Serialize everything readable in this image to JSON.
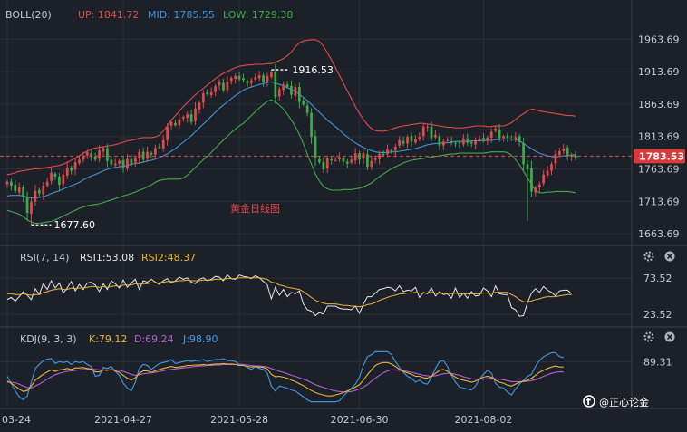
{
  "chart_data": [
    {
      "type": "candlestick",
      "panel": "price",
      "annotation": "黄金日线图",
      "indicator": {
        "label": "BOLL(20)",
        "up": {
          "label": "UP: 1841.72",
          "color": "#e04a4a"
        },
        "mid": {
          "label": "MID: 1785.55",
          "color": "#3f93d6"
        },
        "low": {
          "label": "LOW: 1729.38",
          "color": "#3faa4c"
        }
      },
      "ylim": [
        1650,
        1985
      ],
      "y_ticks": [
        "1963.69",
        "1913.69",
        "1863.69",
        "1813.69",
        "1763.69",
        "1713.69",
        "1663.69"
      ],
      "current_price": "1783.53",
      "current_price_value": 1783.53,
      "high_marker": {
        "label": "1916.53",
        "value": 1916.53
      },
      "low_marker": {
        "label": "1677.60",
        "value": 1677.6
      },
      "up_color": "#e04a4a",
      "down_color": "#3faa4c",
      "close": [
        1744,
        1738,
        1729,
        1735,
        1720,
        1696,
        1713,
        1730,
        1726,
        1738,
        1744,
        1758,
        1752,
        1739,
        1755,
        1766,
        1761,
        1774,
        1778,
        1783,
        1790,
        1783,
        1778,
        1792,
        1796,
        1776,
        1771,
        1772,
        1776,
        1766,
        1779,
        1772,
        1781,
        1790,
        1778,
        1790,
        1786,
        1796,
        1797,
        1808,
        1829,
        1836,
        1831,
        1840,
        1844,
        1848,
        1836,
        1857,
        1866,
        1880,
        1879,
        1882,
        1891,
        1898,
        1885,
        1898,
        1904,
        1907,
        1902,
        1901,
        1896,
        1900,
        1905,
        1908,
        1897,
        1907,
        1913,
        1874,
        1887,
        1894,
        1890,
        1878,
        1890,
        1867,
        1863,
        1850,
        1813,
        1780,
        1774,
        1763,
        1780,
        1777,
        1777,
        1782,
        1775,
        1772,
        1778,
        1788,
        1778,
        1788,
        1767,
        1776,
        1780,
        1787,
        1785,
        1794,
        1792,
        1798,
        1808,
        1803,
        1813,
        1806,
        1810,
        1813,
        1829,
        1829,
        1811,
        1816,
        1800,
        1806,
        1808,
        1804,
        1803,
        1803,
        1811,
        1804,
        1803,
        1808,
        1810,
        1808,
        1812,
        1821,
        1826,
        1811,
        1814,
        1812,
        1809,
        1813,
        1805,
        1771,
        1763,
        1729,
        1735,
        1740,
        1755,
        1761,
        1771,
        1787,
        1791,
        1795,
        1784,
        1785,
        1780
      ],
      "mid": [
        1722,
        1723,
        1723,
        1723,
        1722,
        1720,
        1719,
        1719,
        1720,
        1721,
        1723,
        1726,
        1728,
        1730,
        1733,
        1735,
        1738,
        1740,
        1743,
        1747,
        1750,
        1753,
        1755,
        1758,
        1761,
        1763,
        1765,
        1766,
        1767,
        1768,
        1769,
        1771,
        1772,
        1773,
        1774,
        1776,
        1777,
        1779,
        1781,
        1784,
        1787,
        1791,
        1795,
        1800,
        1805,
        1810,
        1815,
        1821,
        1827,
        1833,
        1839,
        1845,
        1851,
        1857,
        1862,
        1867,
        1872,
        1877,
        1881,
        1885,
        1888,
        1890,
        1892,
        1894,
        1895,
        1897,
        1898,
        1896,
        1894,
        1892,
        1889,
        1886,
        1883,
        1879,
        1874,
        1869,
        1863,
        1857,
        1851,
        1845,
        1839,
        1834,
        1829,
        1824,
        1818,
        1813,
        1808,
        1804,
        1800,
        1797,
        1794,
        1792,
        1790,
        1789,
        1789,
        1789,
        1790,
        1790,
        1791,
        1792,
        1793,
        1794,
        1795,
        1797,
        1799,
        1801,
        1802,
        1803,
        1803,
        1804,
        1804,
        1805,
        1806,
        1806,
        1806,
        1806,
        1807,
        1807,
        1807,
        1807,
        1808,
        1808,
        1809,
        1809,
        1810,
        1810,
        1810,
        1809,
        1807,
        1803,
        1799,
        1795,
        1791,
        1788,
        1786,
        1784,
        1783,
        1782,
        1783,
        1784,
        1784,
        1785,
        1786
      ],
      "up": [
        1755,
        1756,
        1758,
        1760,
        1761,
        1762,
        1763,
        1764,
        1764,
        1765,
        1766,
        1767,
        1768,
        1769,
        1771,
        1774,
        1777,
        1780,
        1784,
        1788,
        1791,
        1794,
        1796,
        1797,
        1798,
        1799,
        1800,
        1801,
        1803,
        1805,
        1807,
        1808,
        1809,
        1811,
        1812,
        1812,
        1812,
        1813,
        1816,
        1822,
        1830,
        1839,
        1846,
        1853,
        1860,
        1866,
        1872,
        1878,
        1883,
        1888,
        1893,
        1898,
        1903,
        1907,
        1911,
        1914,
        1917,
        1920,
        1922,
        1923,
        1924,
        1924,
        1925,
        1925,
        1925,
        1926,
        1926,
        1928,
        1931,
        1934,
        1938,
        1944,
        1952,
        1958,
        1961,
        1962,
        1963,
        1963,
        1960,
        1953,
        1943,
        1932,
        1920,
        1908,
        1896,
        1884,
        1872,
        1860,
        1849,
        1840,
        1832,
        1826,
        1823,
        1822,
        1822,
        1823,
        1825,
        1827,
        1829,
        1830,
        1831,
        1832,
        1833,
        1834,
        1834,
        1833,
        1832,
        1831,
        1830,
        1829,
        1828,
        1828,
        1827,
        1827,
        1827,
        1828,
        1829,
        1830,
        1830,
        1830,
        1829,
        1829,
        1830,
        1830,
        1830,
        1832,
        1835,
        1840,
        1845,
        1849,
        1853,
        1856,
        1855,
        1853,
        1852,
        1851,
        1850,
        1849,
        1848,
        1847,
        1846,
        1846,
        1845
      ],
      "low": [
        1700,
        1698,
        1696,
        1694,
        1690,
        1685,
        1682,
        1680,
        1680,
        1681,
        1682,
        1683,
        1685,
        1688,
        1691,
        1694,
        1697,
        1700,
        1703,
        1705,
        1707,
        1708,
        1709,
        1710,
        1712,
        1714,
        1716,
        1718,
        1720,
        1722,
        1724,
        1726,
        1728,
        1731,
        1733,
        1736,
        1739,
        1743,
        1746,
        1747,
        1748,
        1748,
        1748,
        1748,
        1750,
        1754,
        1760,
        1766,
        1772,
        1778,
        1783,
        1789,
        1796,
        1802,
        1808,
        1814,
        1820,
        1825,
        1830,
        1834,
        1840,
        1846,
        1852,
        1858,
        1863,
        1868,
        1870,
        1867,
        1862,
        1856,
        1848,
        1839,
        1829,
        1817,
        1803,
        1786,
        1771,
        1756,
        1745,
        1737,
        1733,
        1731,
        1731,
        1731,
        1732,
        1732,
        1732,
        1733,
        1734,
        1736,
        1739,
        1742,
        1747,
        1752,
        1756,
        1760,
        1764,
        1767,
        1770,
        1773,
        1775,
        1777,
        1778,
        1779,
        1780,
        1781,
        1782,
        1783,
        1784,
        1785,
        1786,
        1787,
        1787,
        1788,
        1788,
        1788,
        1788,
        1788,
        1788,
        1788,
        1789,
        1790,
        1790,
        1790,
        1790,
        1789,
        1785,
        1778,
        1770,
        1760,
        1750,
        1740,
        1730,
        1727,
        1727,
        1728,
        1728,
        1729,
        1729,
        1729,
        1729,
        1728,
        1727
      ],
      "x_tick_labels": [
        "03-24",
        "2021-04-27",
        "2021-05-28",
        "2021-06-30",
        "2021-08-02"
      ],
      "x_tick_index": [
        0,
        29,
        58,
        88,
        119
      ]
    },
    {
      "type": "line",
      "panel": "rsi",
      "indicator": {
        "label": "RSI(7, 14)",
        "rsi1": {
          "label": "RSI1:53.08",
          "color": "#e6e6e6"
        },
        "rsi2": {
          "label": "RSI2:48.37",
          "color": "#e8b53a"
        }
      },
      "ylim": [
        10,
        90
      ],
      "y_ticks": [
        "73.52",
        "23.52"
      ],
      "rsi1": [
        44,
        47,
        42,
        48,
        55,
        50,
        44,
        59,
        51,
        66,
        58,
        70,
        60,
        67,
        53,
        60,
        69,
        56,
        65,
        58,
        67,
        68,
        64,
        55,
        66,
        58,
        70,
        66,
        60,
        71,
        61,
        67,
        72,
        58,
        70,
        68,
        72,
        68,
        65,
        70,
        73,
        67,
        70,
        75,
        72,
        74,
        68,
        66,
        72,
        74,
        70,
        72,
        76,
        75,
        70,
        78,
        73,
        72,
        78,
        76,
        75,
        73,
        77,
        74,
        69,
        64,
        45,
        61,
        50,
        58,
        48,
        54,
        52,
        56,
        38,
        30,
        28,
        22,
        26,
        24,
        35,
        35,
        35,
        32,
        31,
        31,
        30,
        35,
        25,
        38,
        48,
        48,
        53,
        58,
        59,
        61,
        60,
        56,
        63,
        55,
        57,
        56,
        61,
        47,
        54,
        52,
        60,
        49,
        55,
        51,
        52,
        46,
        60,
        47,
        53,
        46,
        55,
        49,
        50,
        60,
        56,
        48,
        63,
        52,
        51,
        51,
        33,
        30,
        21,
        22,
        40,
        53,
        59,
        54,
        62,
        57,
        54,
        49,
        56,
        57,
        57,
        52
      ],
      "rsi2": [
        52,
        52,
        51,
        51,
        52,
        51,
        50,
        51,
        51,
        54,
        55,
        57,
        58,
        59,
        58,
        58,
        60,
        59,
        60,
        60,
        61,
        62,
        62,
        61,
        62,
        61,
        62,
        63,
        62,
        64,
        64,
        64,
        66,
        65,
        66,
        66,
        67,
        67,
        67,
        68,
        69,
        69,
        69,
        70,
        70,
        71,
        70,
        70,
        70,
        71,
        71,
        71,
        72,
        72,
        72,
        73,
        73,
        73,
        74,
        74,
        74,
        74,
        74,
        74,
        73,
        72,
        68,
        67,
        64,
        63,
        61,
        60,
        59,
        58,
        55,
        51,
        47,
        43,
        41,
        39,
        38,
        38,
        38,
        37,
        36,
        36,
        35,
        35,
        34,
        35,
        37,
        38,
        40,
        43,
        45,
        47,
        49,
        50,
        52,
        52,
        53,
        53,
        54,
        53,
        53,
        53,
        54,
        53,
        53,
        53,
        53,
        52,
        53,
        52,
        52,
        52,
        52,
        52,
        52,
        53,
        53,
        53,
        54,
        54,
        54,
        54,
        51,
        48,
        44,
        41,
        41,
        42,
        44,
        45,
        47,
        48,
        48,
        48,
        49,
        50,
        51,
        51
      ]
    },
    {
      "type": "line",
      "panel": "kdj",
      "indicator": {
        "label": "KDJ(9, 3, 3)",
        "k": {
          "label": "K:79.12",
          "color": "#e8b53a"
        },
        "d": {
          "label": "D:69.24",
          "color": "#b35ed1"
        },
        "j": {
          "label": "J:98.90",
          "color": "#3f9be5"
        }
      },
      "ylim": [
        0,
        118
      ],
      "y_ticks": [
        "89.31"
      ],
      "k": [
        50,
        46,
        40,
        34,
        29,
        31,
        40,
        52,
        58,
        64,
        69,
        73,
        70,
        73,
        74,
        76,
        74,
        77,
        77,
        78,
        76,
        75,
        69,
        69,
        73,
        72,
        74,
        71,
        68,
        62,
        56,
        52,
        57,
        66,
        71,
        71,
        68,
        71,
        74,
        76,
        78,
        80,
        78,
        79,
        80,
        82,
        82,
        83,
        83,
        84,
        83,
        84,
        85,
        85,
        86,
        85,
        85,
        84,
        82,
        82,
        80,
        79,
        80,
        79,
        78,
        75,
        64,
        59,
        60,
        58,
        56,
        52,
        49,
        45,
        41,
        36,
        31,
        27,
        24,
        22,
        20,
        20,
        22,
        24,
        27,
        30,
        34,
        38,
        43,
        52,
        63,
        73,
        82,
        86,
        88,
        88,
        85,
        80,
        74,
        70,
        67,
        64,
        60,
        60,
        57,
        56,
        60,
        66,
        72,
        74,
        70,
        64,
        58,
        54,
        52,
        50,
        48,
        50,
        54,
        58,
        60,
        58,
        52,
        48,
        46,
        42,
        40,
        44,
        48,
        50,
        52,
        56,
        62,
        68,
        72,
        76,
        79,
        81,
        79,
        79
      ],
      "d": [
        48,
        48,
        47,
        44,
        40,
        37,
        36,
        40,
        44,
        49,
        54,
        59,
        63,
        66,
        68,
        70,
        71,
        72,
        73,
        74,
        74,
        75,
        74,
        73,
        73,
        73,
        73,
        73,
        72,
        70,
        67,
        64,
        62,
        63,
        65,
        66,
        67,
        68,
        70,
        71,
        73,
        74,
        75,
        76,
        77,
        78,
        79,
        80,
        81,
        81,
        82,
        82,
        83,
        83,
        84,
        84,
        84,
        84,
        84,
        84,
        83,
        82,
        81,
        81,
        80,
        79,
        76,
        73,
        70,
        68,
        65,
        62,
        60,
        57,
        54,
        51,
        47,
        43,
        40,
        37,
        35,
        32,
        30,
        29,
        28,
        28,
        29,
        31,
        34,
        38,
        43,
        50,
        56,
        62,
        67,
        71,
        73,
        73,
        72,
        71,
        70,
        68,
        66,
        64,
        62,
        61,
        60,
        61,
        63,
        65,
        66,
        66,
        64,
        62,
        59,
        57,
        55,
        54,
        54,
        54,
        55,
        56,
        55,
        54,
        53,
        51,
        49,
        49,
        49,
        49,
        50,
        51,
        53,
        56,
        60,
        63,
        66,
        68,
        69,
        69
      ],
      "j": [
        60,
        46,
        30,
        18,
        12,
        20,
        48,
        76,
        84,
        92,
        95,
        96,
        86,
        90,
        88,
        90,
        84,
        90,
        88,
        90,
        84,
        80,
        60,
        62,
        78,
        76,
        80,
        70,
        62,
        46,
        36,
        30,
        48,
        76,
        84,
        82,
        74,
        80,
        86,
        88,
        90,
        94,
        86,
        88,
        90,
        92,
        90,
        92,
        92,
        94,
        90,
        92,
        94,
        94,
        96,
        92,
        92,
        90,
        84,
        84,
        78,
        74,
        80,
        76,
        74,
        66,
        40,
        30,
        40,
        38,
        36,
        32,
        30,
        24,
        18,
        12,
        8,
        8,
        8,
        8,
        8,
        8,
        8,
        10,
        20,
        28,
        36,
        44,
        58,
        82,
        100,
        104,
        110,
        110,
        110,
        110,
        104,
        90,
        78,
        68,
        60,
        56,
        48,
        52,
        46,
        44,
        58,
        76,
        90,
        92,
        80,
        62,
        48,
        38,
        36,
        34,
        32,
        40,
        54,
        64,
        72,
        66,
        46,
        38,
        36,
        28,
        22,
        34,
        44,
        52,
        60,
        64,
        80,
        92,
        100,
        104,
        108,
        108,
        100,
        98
      ]
    }
  ],
  "watermark": "@正心论金"
}
